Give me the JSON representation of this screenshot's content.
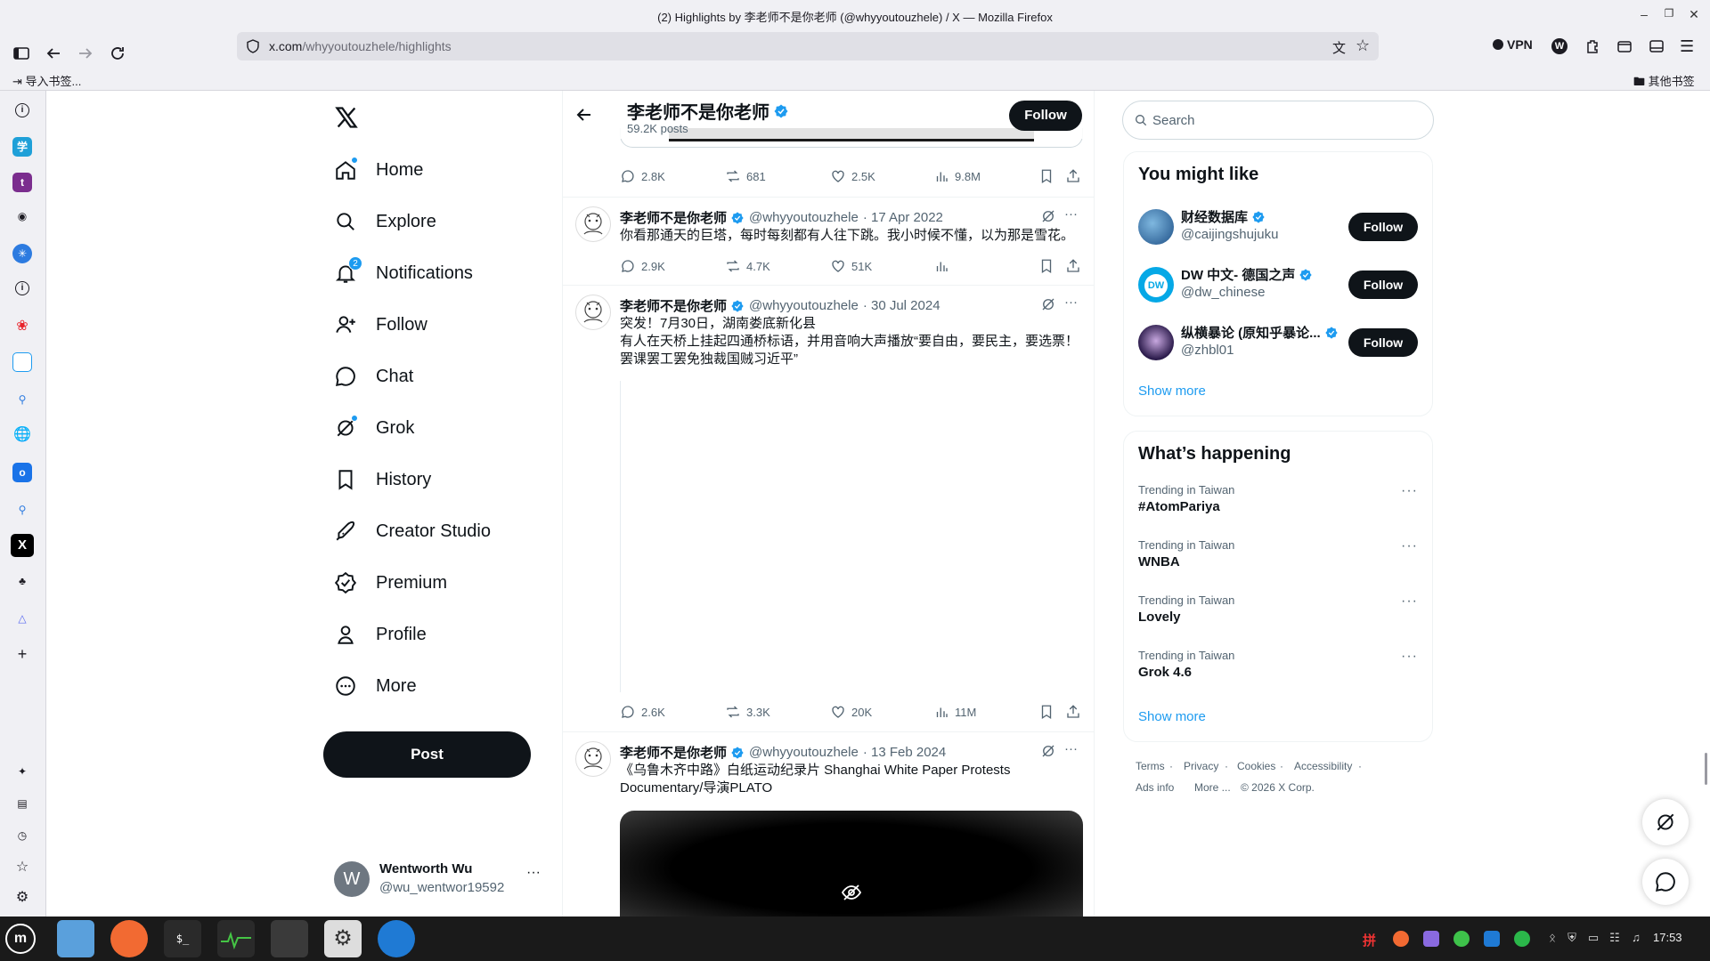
{
  "window": {
    "title": "(2) Highlights by 李老师不是你老师 (@whyyoutouzhele) / X — Mozilla Firefox"
  },
  "browser": {
    "url_host": "x.com",
    "url_path": "/whyyoutouzhele/highlights",
    "vpn_label": "VPN",
    "bookmark_import": "导入书签...",
    "bookmark_other": "其他书签"
  },
  "nav": {
    "items": [
      {
        "label": "Home",
        "icon": "home-icon"
      },
      {
        "label": "Explore",
        "icon": "search-icon"
      },
      {
        "label": "Notifications",
        "icon": "bell-icon",
        "badge": "2"
      },
      {
        "label": "Follow",
        "icon": "person-add-icon"
      },
      {
        "label": "Chat",
        "icon": "chat-icon"
      },
      {
        "label": "Grok",
        "icon": "grok-icon"
      },
      {
        "label": "History",
        "icon": "bookmark-icon"
      },
      {
        "label": "Creator Studio",
        "icon": "rocket-icon"
      },
      {
        "label": "Premium",
        "icon": "verified-icon"
      },
      {
        "label": "Profile",
        "icon": "person-icon"
      },
      {
        "label": "More",
        "icon": "more-circle-icon"
      }
    ],
    "post_label": "Post"
  },
  "account": {
    "initial": "W",
    "name": "Wentworth Wu",
    "handle": "@wu_wentwor19592"
  },
  "profile_header": {
    "name": "李老师不是你老师",
    "posts": "59.2K posts",
    "follow_label": "Follow"
  },
  "tweets": [
    {
      "replies": "2.8K",
      "reposts": "681",
      "likes": "2.5K",
      "views": "9.8M"
    },
    {
      "name": "李老师不是你老师",
      "handle": "@whyyoutouzhele",
      "date": "· 17 Apr 2022",
      "text": "你看那通天的巨塔，每时每刻都有人往下跳。我小时候不懂，以为那是雪花。",
      "replies": "2.9K",
      "reposts": "4.7K",
      "likes": "51K",
      "views": ""
    },
    {
      "name": "李老师不是你老师",
      "handle": "@whyyoutouzhele",
      "date": "· 30 Jul 2024",
      "text1": "突发！7月30日，湖南娄底新化县",
      "text2": "有人在天桥上挂起四通桥标语，并用音响大声播放“要自由，要民主，要选票！罢课罢工罢免独裁国贼习近平”",
      "replies": "2.6K",
      "reposts": "3.3K",
      "likes": "20K",
      "views": "11M"
    },
    {
      "name": "李老师不是你老师",
      "handle": "@whyyoutouzhele",
      "date": "· 13 Feb 2024",
      "text1": "《乌鲁木齐中路》白纸运动纪录片 Shanghai White Paper Protests",
      "text2": "Documentary/导演PLATO"
    }
  ],
  "search": {
    "placeholder": "Search"
  },
  "you_might_like": {
    "title": "You might like",
    "users": [
      {
        "name": "财经数据库",
        "handle": "@caijingshujuku",
        "follow": "Follow"
      },
      {
        "name": "DW 中文- 德国之声",
        "handle": "@dw_chinese",
        "follow": "Follow"
      },
      {
        "name": "纵横暴论 (原知乎暴论...",
        "handle": "@zhbl01",
        "follow": "Follow"
      }
    ],
    "show_more": "Show more"
  },
  "happening": {
    "title": "What’s happening",
    "trends": [
      {
        "context": "Trending in Taiwan",
        "topic": "#AtomPariya"
      },
      {
        "context": "Trending in Taiwan",
        "topic": "WNBA"
      },
      {
        "context": "Trending in Taiwan",
        "topic": "Lovely"
      },
      {
        "context": "Trending in Taiwan",
        "topic": "Grok 4.6"
      }
    ],
    "show_more": "Show more"
  },
  "footer": {
    "terms": "Terms",
    "privacy": "Privacy",
    "cookies": "Cookies",
    "accessibility": "Accessibility",
    "ads": "Ads info",
    "more": "More ...",
    "copyright": "© 2026 X Corp."
  },
  "taskbar": {
    "time": "17:53"
  },
  "colors": {
    "accent": "#1d9bf0",
    "text": "#0f1419",
    "muted": "#536471",
    "chrome": "#f0f0f4"
  }
}
